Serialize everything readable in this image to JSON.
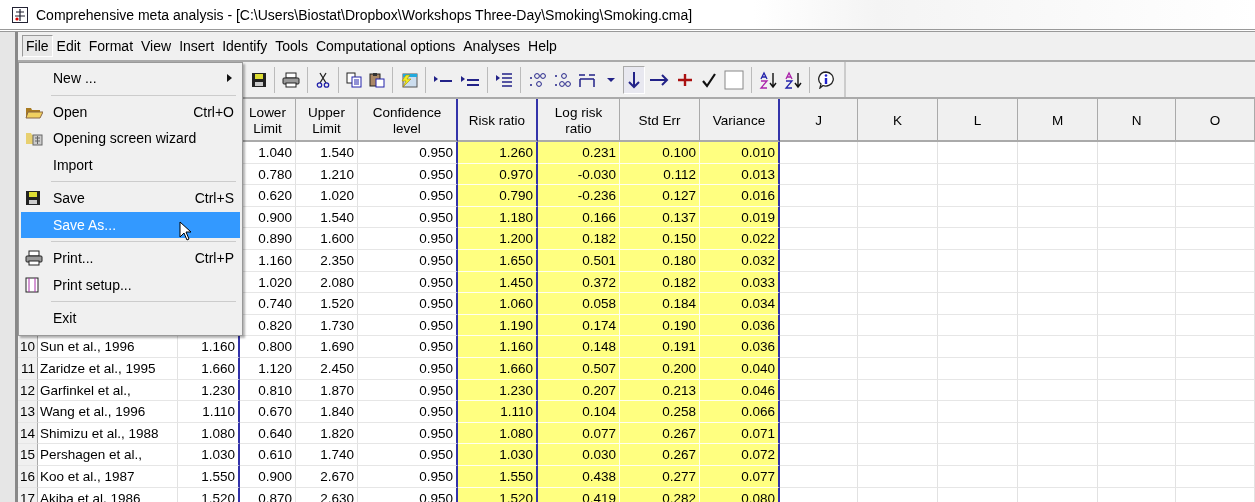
{
  "window": {
    "title": "Comprehensive meta analysis - [C:\\Users\\Biostat\\Dropbox\\Workshops Three-Day\\Smoking\\Smoking.cma]"
  },
  "menubar": [
    {
      "label": "File",
      "selected": true
    },
    {
      "label": "Edit",
      "selected": false
    },
    {
      "label": "Format",
      "selected": false
    },
    {
      "label": "View",
      "selected": false
    },
    {
      "label": "Insert",
      "selected": false
    },
    {
      "label": "Identify",
      "selected": false
    },
    {
      "label": "Tools",
      "selected": false
    },
    {
      "label": "Computational options",
      "selected": false
    },
    {
      "label": "Analyses",
      "selected": false
    },
    {
      "label": "Help",
      "selected": false
    }
  ],
  "file_menu": [
    {
      "kind": "item",
      "label": "New ...",
      "submenu": true,
      "selected": false
    },
    {
      "kind": "separator"
    },
    {
      "kind": "item",
      "label": "Open",
      "shortcut": "Ctrl+O",
      "selected": false
    },
    {
      "kind": "item",
      "label": "Opening screen wizard",
      "selected": false
    },
    {
      "kind": "item",
      "label": "Import",
      "selected": false
    },
    {
      "kind": "separator"
    },
    {
      "kind": "item",
      "label": "Save",
      "shortcut": "Ctrl+S",
      "selected": false
    },
    {
      "kind": "item",
      "label": "Save As...",
      "selected": true
    },
    {
      "kind": "separator"
    },
    {
      "kind": "item",
      "label": "Print...",
      "shortcut": "Ctrl+P",
      "selected": false
    },
    {
      "kind": "item",
      "label": "Print setup...",
      "selected": false
    },
    {
      "kind": "separator"
    },
    {
      "kind": "item",
      "label": "Exit",
      "selected": false
    }
  ],
  "toolbar": [
    {
      "kind": "save"
    },
    {
      "kind": "print"
    },
    {
      "kind": "cut"
    },
    {
      "kind": "copy"
    },
    {
      "kind": "paste"
    },
    {
      "kind": "form"
    },
    {
      "kind": "indent1"
    },
    {
      "kind": "indent2"
    },
    {
      "kind": "list"
    },
    {
      "kind": "decmore"
    },
    {
      "kind": "decless"
    },
    {
      "kind": "colwidth"
    },
    {
      "kind": "dropdown"
    },
    {
      "kind": "down",
      "selected": true
    },
    {
      "kind": "right",
      "selected": false
    },
    {
      "kind": "plus"
    },
    {
      "kind": "check"
    },
    {
      "kind": "box"
    },
    {
      "kind": "sortaz"
    },
    {
      "kind": "sortza"
    },
    {
      "kind": "info"
    }
  ],
  "table": {
    "columns": [
      "Lower Limit",
      "Upper Limit",
      "Confidence level",
      "Risk ratio",
      "Log risk ratio",
      "Std Err",
      "Variance",
      "J",
      "K",
      "L",
      "M",
      "N",
      "O"
    ],
    "rows": [
      {
        "values": [
          "1.040",
          "1.540",
          "0.950",
          "1.260",
          "0.231",
          "0.100",
          "0.010"
        ]
      },
      {
        "values": [
          "0.780",
          "1.210",
          "0.950",
          "0.970",
          "-0.030",
          "0.112",
          "0.013"
        ]
      },
      {
        "values": [
          "0.620",
          "1.020",
          "0.950",
          "0.790",
          "-0.236",
          "0.127",
          "0.016"
        ]
      },
      {
        "values": [
          "0.900",
          "1.540",
          "0.950",
          "1.180",
          "0.166",
          "0.137",
          "0.019"
        ]
      },
      {
        "values": [
          "0.890",
          "1.600",
          "0.950",
          "1.200",
          "0.182",
          "0.150",
          "0.022"
        ]
      },
      {
        "values": [
          "1.160",
          "2.350",
          "0.950",
          "1.650",
          "0.501",
          "0.180",
          "0.032"
        ]
      },
      {
        "values": [
          "1.020",
          "2.080",
          "0.950",
          "1.450",
          "0.372",
          "0.182",
          "0.033"
        ]
      },
      {
        "values": [
          "0.740",
          "1.520",
          "0.950",
          "1.060",
          "0.058",
          "0.184",
          "0.034"
        ]
      },
      {
        "values": [
          "0.820",
          "1.730",
          "0.950",
          "1.190",
          "0.174",
          "0.190",
          "0.036"
        ]
      },
      {
        "number": "10",
        "study": "Sun et al., 1996",
        "effect": "1.160",
        "values": [
          "0.800",
          "1.690",
          "0.950",
          "1.160",
          "0.148",
          "0.191",
          "0.036"
        ]
      },
      {
        "number": "11",
        "study": "Zaridze et al., 1995",
        "effect": "1.660",
        "values": [
          "1.120",
          "2.450",
          "0.950",
          "1.660",
          "0.507",
          "0.200",
          "0.040"
        ]
      },
      {
        "number": "12",
        "study": "Garfinkel et al.,",
        "effect": "1.230",
        "values": [
          "0.810",
          "1.870",
          "0.950",
          "1.230",
          "0.207",
          "0.213",
          "0.046"
        ]
      },
      {
        "number": "13",
        "study": "Wang et al., 1996",
        "effect": "1.110",
        "values": [
          "0.670",
          "1.840",
          "0.950",
          "1.110",
          "0.104",
          "0.258",
          "0.066"
        ]
      },
      {
        "number": "14",
        "study": "Shimizu et al., 1988",
        "effect": "1.080",
        "values": [
          "0.640",
          "1.820",
          "0.950",
          "1.080",
          "0.077",
          "0.267",
          "0.071"
        ]
      },
      {
        "number": "15",
        "study": "Pershagen et al.,",
        "effect": "1.030",
        "values": [
          "0.610",
          "1.740",
          "0.950",
          "1.030",
          "0.030",
          "0.267",
          "0.072"
        ]
      },
      {
        "number": "16",
        "study": "Koo et al., 1987",
        "effect": "1.550",
        "values": [
          "0.900",
          "2.670",
          "0.950",
          "1.550",
          "0.438",
          "0.277",
          "0.077"
        ]
      },
      {
        "number": "17",
        "study": "Akiba et al. 1986",
        "effect": "1.520",
        "values": [
          "0.870",
          "2.630",
          "0.950",
          "1.520",
          "0.419",
          "0.282",
          "0.080"
        ]
      }
    ]
  }
}
